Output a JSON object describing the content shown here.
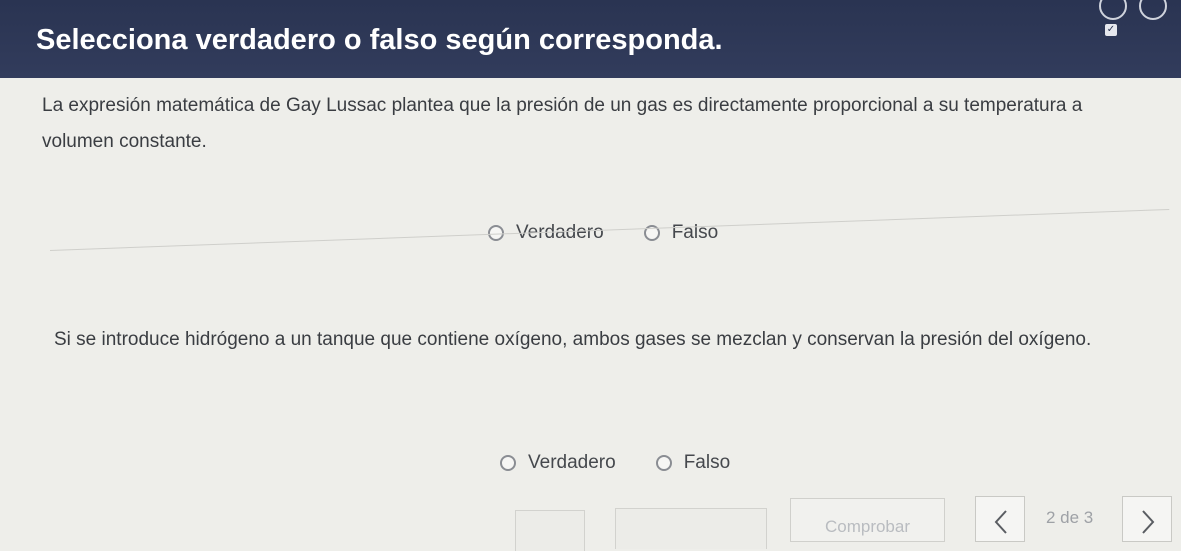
{
  "header": {
    "title": "Selecciona verdadero o falso según corresponda.",
    "bg_color": "#2a3452"
  },
  "questions": [
    {
      "text": "La expresión matemática de Gay Lussac plantea que la presión de un gas es directamente proporcional a su temperatura a volumen constante.",
      "options": [
        "Verdadero",
        "Falso"
      ]
    },
    {
      "text": "Si se introduce hidrógeno a un tanque que contiene oxígeno, ambos gases se mezclan y conservan la presión del oxígeno.",
      "options": [
        "Verdadero",
        "Falso"
      ]
    }
  ],
  "footer": {
    "check_label": "Comprobar",
    "page_indicator": "2 de 3",
    "prev_icon": "chevron-left-icon",
    "next_icon": "chevron-right-icon"
  }
}
